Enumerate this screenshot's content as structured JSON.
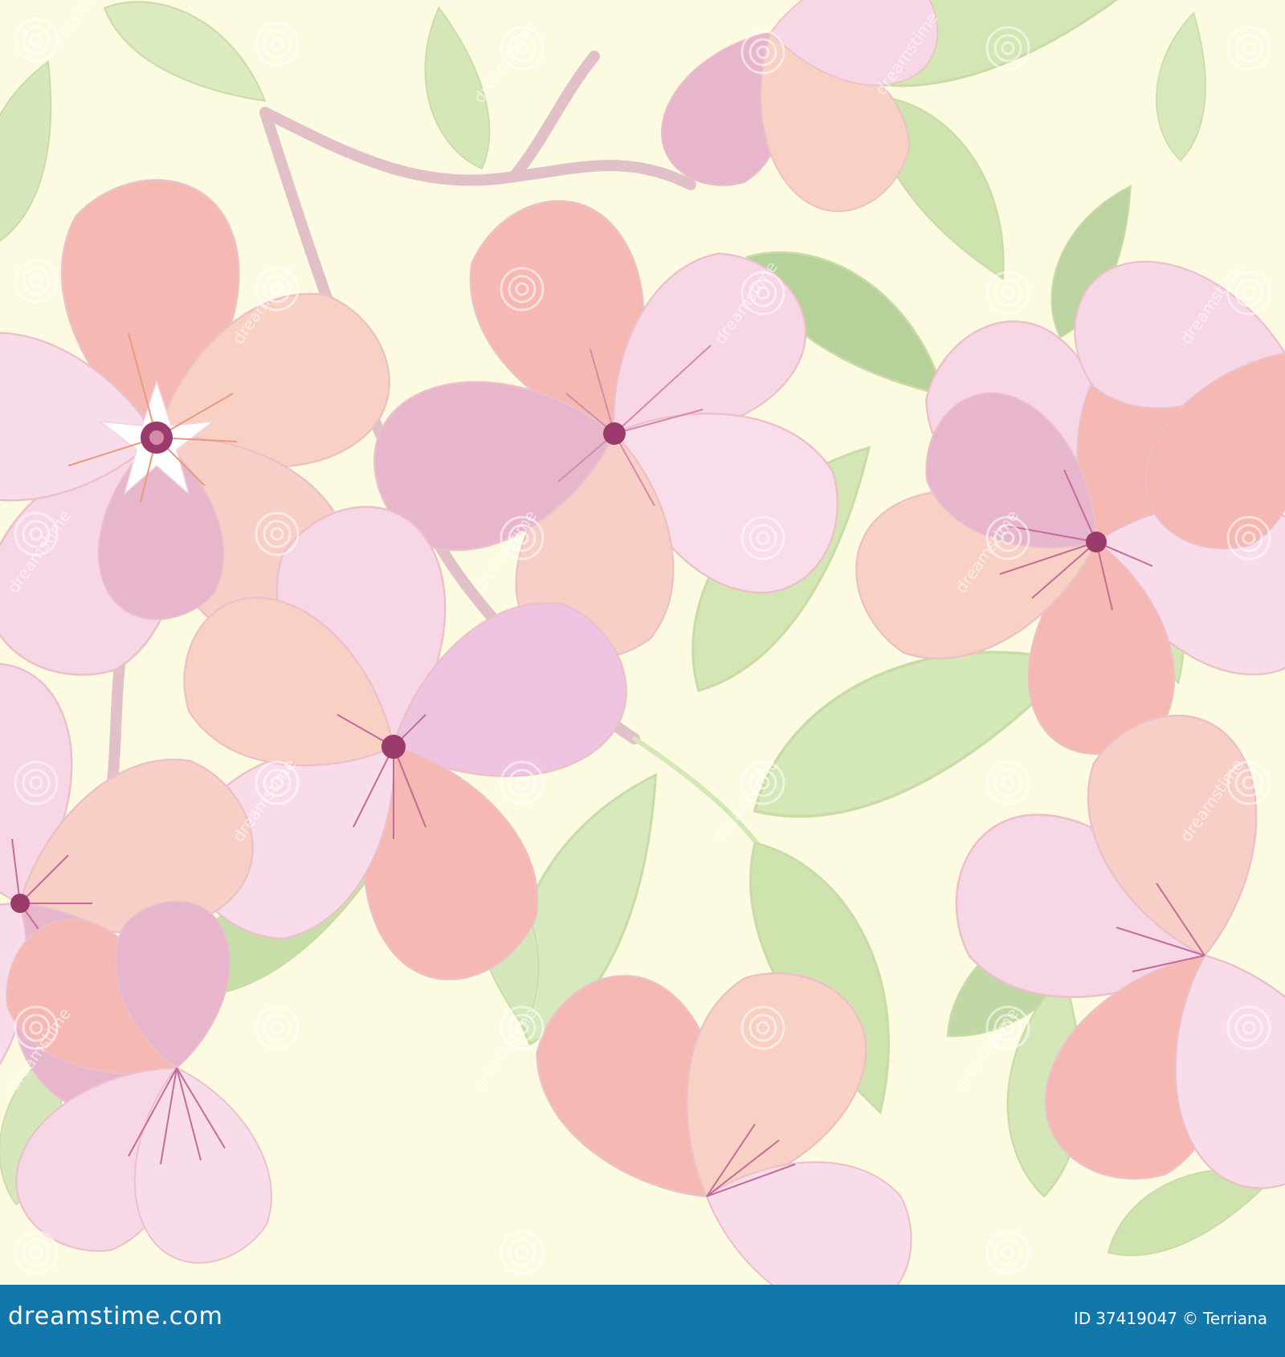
{
  "image": {
    "description_tags": [
      "floral",
      "seamless",
      "pastel"
    ],
    "background_color": "#fcfbe2",
    "palette": {
      "petal_pink": "#f7d6e6",
      "petal_salmon": "#f6b8b2",
      "petal_peach": "#f8d0c4",
      "petal_mauve": "#e7b6cd",
      "petal_lilac": "#efc3e2",
      "stamen": "#c46c98",
      "center": "#9a3b6c",
      "leaf_light": "#dbeabf",
      "leaf_mid": "#c7dfa6",
      "leaf_dark": "#b7d19a",
      "stem": "#e2b8c4"
    }
  },
  "footer": {
    "background_color": "#1278ac",
    "brand": "dreamstime.com",
    "id_label": "ID",
    "id_value": "37419047",
    "copyright_symbol": "©",
    "author": "Terriana"
  },
  "watermark": {
    "text": "dreamstime",
    "icon": "spiral-logo-icon"
  }
}
